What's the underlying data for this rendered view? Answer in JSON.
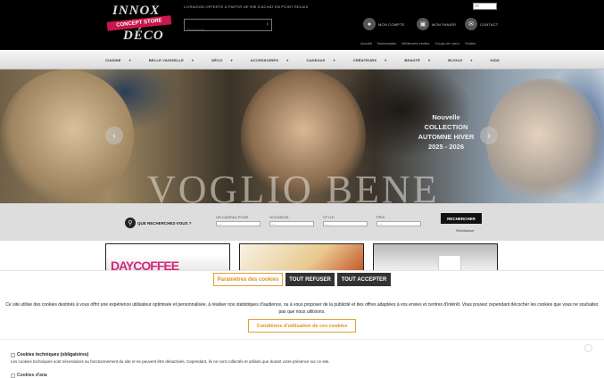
{
  "brand": {
    "logo_top": "INNOX",
    "logo_band": "CONCEPT STORE",
    "logo_bottom": "DÉCO"
  },
  "header": {
    "promo": "LIVRAISON OFFERTE À PARTIR DE 99€ D'ACHAT EN POINT RELAIS",
    "search_placeholder": "Recherche...",
    "language": "Fr",
    "account_label": "MON COMPTE",
    "cart_label": "MON PANIER",
    "contact_label": "CONTACT",
    "links": [
      "Accueil",
      "Nouveautés",
      "Meilleures ventes",
      "Coups de cœur",
      "Soldes"
    ]
  },
  "nav": {
    "items": [
      "CUISINE",
      "BELLE VAISSELLE",
      "DÉCO",
      "ACCESSOIRES",
      "CADEAUX",
      "CRÉATEURS",
      "BEAUTÉ",
      "BIJOUX",
      "KIDS"
    ]
  },
  "hero": {
    "title": "VOGLIO BENE",
    "collection": [
      "Nouvelle",
      "COLLECTION",
      "AUTOMNE HIVER",
      "2025 - 2026"
    ]
  },
  "filter": {
    "label": "QUE RECHERCHEZ-VOUS ?",
    "groups": [
      {
        "label": "UN CADEAU POUR",
        "value": "-----"
      },
      {
        "label": "OCCASION",
        "value": "-----"
      },
      {
        "label": "STYLE",
        "value": "-----"
      },
      {
        "label": "PRIX",
        "value": "-----"
      }
    ],
    "search_button": "RECHERCHER",
    "reset": "Réinitialiser"
  },
  "cards": [
    {
      "text": "DAYCOFFEE"
    }
  ],
  "cookie": {
    "settings_button": "Paramètres des cookies",
    "refuse_button": "TOUT REFUSER",
    "accept_button": "TOUT ACCEPTER",
    "text": "Ce site utilise des cookies destinés à vous offrir une expérience utilisateur optimisée et personnalisée, à réaliser nos statistiques d'audience, ou à vous proposer de la publicité et des offres adaptées à vos envies et centres d'intérêt. Vous pouvez cependant décocher les cookies que vous ne souhaitez pas que nous utilisions.",
    "conditions_button": "Conditions d'utilisation de ces cookies",
    "technical_title": "Cookies techniques (obligatoires)",
    "technical_text": "Les cookies techniques sont nécessaires au fonctionnement du site et ne peuvent être désactivés. Cependant, ils ne sont collectés et utilisés que durant votre présence sur ce site.",
    "next_title": "Cookies d'ana"
  }
}
